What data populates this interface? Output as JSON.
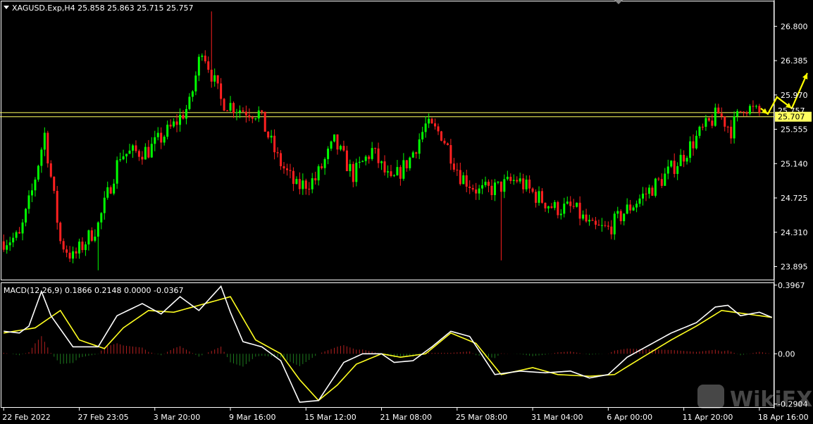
{
  "header": {
    "symbol_label": "XAGUSD.Exp,H4  25.858 25.863 25.715 25.757",
    "macd_label": "MACD(12,26,9) 0.1866 0.2148 0.0000 -0.0367"
  },
  "watermark": {
    "text": "WikiFX"
  },
  "colors": {
    "bull": "#00ff00",
    "bear": "#ff2020",
    "hline": "#ffff60",
    "macd_line": "#ffffff",
    "signal_line": "#ffff20",
    "hist_up": "#b22020",
    "hist_down": "#1e7a1e",
    "arrows": "#ffff00"
  },
  "chart_data": [
    {
      "type": "candlestick",
      "title": "XAGUSD.Exp,H4",
      "ohlc": [
        25.858,
        25.863,
        25.715,
        25.757
      ],
      "y_ticks": [
        "26.800",
        "26.385",
        "25.970",
        "25.555",
        "25.140",
        "24.725",
        "24.310",
        "23.895"
      ],
      "ylim": [
        23.78,
        27.05
      ],
      "x_ticks": [
        "22 Feb 2022",
        "27 Feb 23:05",
        "3 Mar 20:00",
        "9 Mar 16:00",
        "15 Mar 12:00",
        "21 Mar 08:00",
        "25 Mar 08:00",
        "31 Mar 04:00",
        "6 Apr 00:00",
        "11 Apr 20:00",
        "18 Apr 16:00"
      ],
      "price_labels": [
        "25.757",
        "25.707"
      ],
      "horizontal_lines": [
        25.757,
        25.707
      ],
      "anchors": [
        [
          0,
          24.2
        ],
        [
          6,
          24.25
        ],
        [
          10,
          24.8
        ],
        [
          14,
          25.5
        ],
        [
          19,
          24.2
        ],
        [
          23,
          24.0
        ],
        [
          31,
          24.4
        ],
        [
          38,
          25.25
        ],
        [
          47,
          25.3
        ],
        [
          55,
          25.6
        ],
        [
          60,
          25.85
        ],
        [
          64,
          26.55
        ],
        [
          70,
          25.9
        ],
        [
          76,
          25.8
        ],
        [
          82,
          25.75
        ],
        [
          88,
          25.2
        ],
        [
          94,
          24.85
        ],
        [
          100,
          24.95
        ],
        [
          106,
          25.4
        ],
        [
          112,
          25.0
        ],
        [
          118,
          25.3
        ],
        [
          124,
          24.9
        ],
        [
          130,
          25.2
        ],
        [
          135,
          25.6
        ],
        [
          140,
          25.5
        ],
        [
          146,
          25.0
        ],
        [
          152,
          24.8
        ],
        [
          158,
          24.85
        ],
        [
          164,
          24.95
        ],
        [
          170,
          24.75
        ],
        [
          176,
          24.6
        ],
        [
          182,
          24.6
        ],
        [
          188,
          24.35
        ],
        [
          193,
          24.35
        ],
        [
          198,
          24.55
        ],
        [
          204,
          24.75
        ],
        [
          210,
          24.95
        ],
        [
          216,
          25.2
        ],
        [
          222,
          25.5
        ],
        [
          228,
          25.75
        ],
        [
          232,
          25.55
        ],
        [
          236,
          25.85
        ],
        [
          240,
          25.757
        ]
      ]
    },
    {
      "type": "line",
      "title": "MACD(12,26,9)",
      "values": {
        "macd": 0.1866,
        "signal": 0.2148
      },
      "y_ticks": [
        "0.3967",
        "0.00",
        "-0.2904"
      ],
      "ylim": [
        -0.3,
        0.4
      ],
      "macd_anchors": [
        [
          0,
          0.13
        ],
        [
          5,
          0.12
        ],
        [
          8,
          0.16
        ],
        [
          12,
          0.36
        ],
        [
          15,
          0.22
        ],
        [
          22,
          0.04
        ],
        [
          30,
          0.04
        ],
        [
          36,
          0.22
        ],
        [
          44,
          0.29
        ],
        [
          50,
          0.23
        ],
        [
          56,
          0.33
        ],
        [
          62,
          0.25
        ],
        [
          67,
          0.35
        ],
        [
          69,
          0.39
        ],
        [
          72,
          0.24
        ],
        [
          76,
          0.07
        ],
        [
          82,
          0.04
        ],
        [
          88,
          -0.04
        ],
        [
          94,
          -0.28
        ],
        [
          100,
          -0.27
        ],
        [
          108,
          -0.05
        ],
        [
          114,
          0.0
        ],
        [
          120,
          0.0
        ],
        [
          124,
          -0.05
        ],
        [
          130,
          -0.04
        ],
        [
          136,
          0.04
        ],
        [
          142,
          0.13
        ],
        [
          148,
          0.1
        ],
        [
          156,
          -0.12
        ],
        [
          164,
          -0.1
        ],
        [
          172,
          -0.11
        ],
        [
          180,
          -0.1
        ],
        [
          186,
          -0.14
        ],
        [
          192,
          -0.12
        ],
        [
          198,
          -0.02
        ],
        [
          204,
          0.04
        ],
        [
          212,
          0.12
        ],
        [
          220,
          0.18
        ],
        [
          226,
          0.27
        ],
        [
          230,
          0.28
        ],
        [
          234,
          0.22
        ],
        [
          240,
          0.24
        ],
        [
          244,
          0.21
        ]
      ],
      "signal_anchors": [
        [
          0,
          0.12
        ],
        [
          10,
          0.15
        ],
        [
          18,
          0.25
        ],
        [
          24,
          0.08
        ],
        [
          32,
          0.03
        ],
        [
          38,
          0.15
        ],
        [
          46,
          0.25
        ],
        [
          54,
          0.24
        ],
        [
          62,
          0.28
        ],
        [
          72,
          0.33
        ],
        [
          80,
          0.08
        ],
        [
          88,
          0.0
        ],
        [
          94,
          -0.15
        ],
        [
          100,
          -0.27
        ],
        [
          106,
          -0.18
        ],
        [
          112,
          -0.06
        ],
        [
          120,
          0.0
        ],
        [
          126,
          -0.02
        ],
        [
          134,
          0.0
        ],
        [
          142,
          0.12
        ],
        [
          150,
          0.06
        ],
        [
          158,
          -0.12
        ],
        [
          168,
          -0.08
        ],
        [
          176,
          -0.12
        ],
        [
          186,
          -0.13
        ],
        [
          194,
          -0.12
        ],
        [
          202,
          -0.03
        ],
        [
          212,
          0.08
        ],
        [
          220,
          0.16
        ],
        [
          228,
          0.25
        ],
        [
          236,
          0.23
        ],
        [
          244,
          0.21
        ]
      ]
    }
  ]
}
